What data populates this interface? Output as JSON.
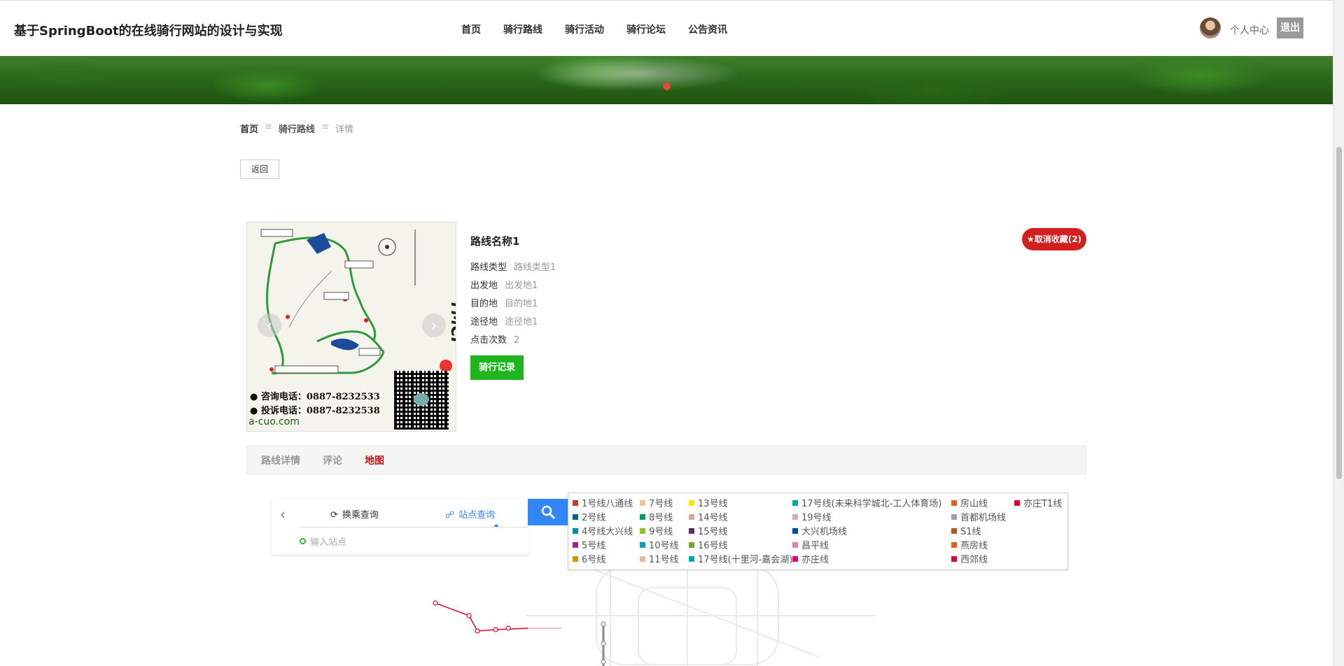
{
  "header": {
    "site_title": "基于SpringBoot的在线骑行网站的设计与实现",
    "nav": [
      "首页",
      "骑行路线",
      "骑行活动",
      "骑行论坛",
      "公告资讯"
    ],
    "user_center": "个人中心",
    "logout": "退出"
  },
  "breadcrumb": {
    "home": "首页",
    "section": "骑行路线",
    "current": "详情",
    "separator": "≡"
  },
  "back_button": "返回",
  "route": {
    "name": "路线名称1",
    "favorite_button": "★取消收藏(2)",
    "fields": [
      {
        "label": "路线类型",
        "value": "路线类型1"
      },
      {
        "label": "出发地",
        "value": "出发地1"
      },
      {
        "label": "目的地",
        "value": "目的地1"
      },
      {
        "label": "途径地",
        "value": "途径地1"
      },
      {
        "label": "点击次数",
        "value": "2"
      }
    ],
    "ride_record_button": "骑行记录",
    "photo": {
      "phone1": "● 咨询电话：0887-8232533",
      "phone2": "● 投诉电话：0887-8232538",
      "site": "a-cuo.com",
      "brand": "YMCI"
    }
  },
  "tabs": [
    {
      "label": "路线详情",
      "active": false
    },
    {
      "label": "评论",
      "active": false
    },
    {
      "label": "地图",
      "active": true
    }
  ],
  "map_search": {
    "back": "‹",
    "transfer_tab": "换乘查询",
    "station_tab": "站点查询",
    "input_placeholder": "输入站点"
  },
  "subway_legend": [
    {
      "name": "1号线八通线",
      "color": "#c23a30"
    },
    {
      "name": "2号线",
      "color": "#006098"
    },
    {
      "name": "4号线大兴线",
      "color": "#008e9c"
    },
    {
      "name": "5号线",
      "color": "#a6217f"
    },
    {
      "name": "6号线",
      "color": "#d29700"
    },
    {
      "name": "7号线",
      "color": "#f6c582"
    },
    {
      "name": "8号线",
      "color": "#009b6b"
    },
    {
      "name": "9号线",
      "color": "#8fc31f"
    },
    {
      "name": "10号线",
      "color": "#009bc0"
    },
    {
      "name": "11号线",
      "color": "#e6b99d"
    },
    {
      "name": "13号线",
      "color": "#f9e700"
    },
    {
      "name": "14号线",
      "color": "#d5a7a1"
    },
    {
      "name": "15号线",
      "color": "#5b2c68"
    },
    {
      "name": "16号线",
      "color": "#76a32e"
    },
    {
      "name": "17号线(十里河-嘉会湖)",
      "color": "#00a9a9"
    },
    {
      "name": "17号线(未来科学城北-工人体育场)",
      "color": "#00a9a9"
    },
    {
      "name": "19号线",
      "color": "#d6abc1"
    },
    {
      "name": "大兴机场线",
      "color": "#004a9d"
    },
    {
      "name": "昌平线",
      "color": "#de82b2"
    },
    {
      "name": "亦庄线",
      "color": "#e40077"
    },
    {
      "name": "房山线",
      "color": "#e46022"
    },
    {
      "name": "首都机场线",
      "color": "#a29bbb"
    },
    {
      "name": "S1线",
      "color": "#b35a20"
    },
    {
      "name": "燕房线",
      "color": "#e46022"
    },
    {
      "name": "西郊线",
      "color": "#e6002c"
    },
    {
      "name": "亦庄T1线",
      "color": "#e6002c"
    }
  ]
}
